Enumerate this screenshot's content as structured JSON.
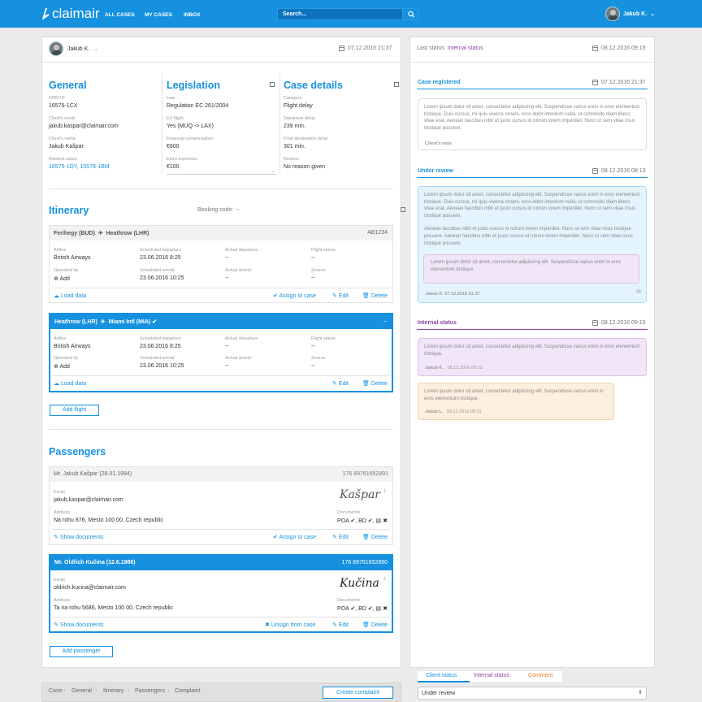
{
  "brand": {
    "name": "claimair"
  },
  "nav": {
    "all_cases": "ALL CASES",
    "my_cases": "MY CASES",
    "inbox": "INBOX"
  },
  "search": {
    "placeholder": "Search..."
  },
  "user": {
    "name": "Jakub K."
  },
  "left": {
    "assignee": "Jakub K.",
    "date": "07.12.2016 21:37",
    "general": {
      "title": "General",
      "crm_lbl": "CRM ID",
      "crm": "16576-1CX",
      "email_lbl": "Client's email",
      "email": "jakub.kaspar@claimair.com",
      "name_lbl": "Client's name",
      "name": "Jakub Kašpar",
      "rel_lbl": "Related cases",
      "rel": "16575-1DY, 15578-1BM"
    },
    "legislation": {
      "title": "Legislation",
      "law_lbl": "Law",
      "law": "Regulation EC 261/2004",
      "eu_lbl": "EU flight",
      "eu": "Yes (MUQ -> LAX)",
      "comp_lbl": "Financial compensation",
      "comp": "€600",
      "extra_lbl": "Extra expenses",
      "extra": "€100"
    },
    "details": {
      "title": "Case details",
      "cat_lbl": "Category",
      "cat": "Flight delay",
      "dep_lbl": "Departure delay",
      "dep": "239 min.",
      "fin_lbl": "Final destination delay",
      "fin": "301 min.",
      "reason_lbl": "Reason",
      "reason": "No reason given"
    },
    "itinerary": {
      "title": "Itinerary",
      "booking": "Booking code: --",
      "flights": [
        {
          "from": "Ferihegy (BUD)",
          "to": "Heathrow (LHR)",
          "code": "AB1234",
          "airline_lbl": "Airline",
          "airline": "British Airways",
          "sdep_lbl": "Scheduled departure",
          "sdep": "23.06.2016 8:25",
          "adep_lbl": "Actual departure",
          "adep": "--",
          "status_lbl": "Flight status",
          "status": "--",
          "op_lbl": "Operated by",
          "op": "Add",
          "sarr_lbl": "Scheduled arrival",
          "sarr": "23.06.2016 10:25",
          "aarr_lbl": "Actual arrival",
          "aarr": "--",
          "src_lbl": "Source",
          "src": "--",
          "load": "Load data",
          "assign": "Assign to case",
          "edit": "Edit",
          "del": "Delete"
        },
        {
          "from": "Heathrow (LHR)",
          "to": "Miami Intl (MIA)",
          "code": "–",
          "airline_lbl": "Airline",
          "airline": "British Airways",
          "sdep_lbl": "Scheduled departure",
          "sdep": "23.06.2016 8:25",
          "adep_lbl": "Actual departure",
          "adep": "--",
          "status_lbl": "Flight status",
          "status": "--",
          "op_lbl": "Operated by",
          "op": "Add",
          "sarr_lbl": "Scheduled arrival",
          "sarr": "23.06.2016 10:25",
          "aarr_lbl": "Actual arrival",
          "aarr": "--",
          "src_lbl": "Source",
          "src": "--",
          "load": "Load data",
          "edit": "Edit",
          "del": "Delete"
        }
      ],
      "add_flight": "Add flight"
    },
    "passengers": {
      "title": "Passengers",
      "list": [
        {
          "name": "Mr. Jakub Kašpar (28.01.1994)",
          "num": "176 89761652891",
          "email_lbl": "Email",
          "email": "jakub.kaspar@claimair.com",
          "addr_lbl": "Address",
          "addr": "Na rohu 876, Mesto 100 00, Czech republic",
          "docs_lbl": "Documents",
          "docs": "POA ✔, BD ✔, ▤ ✖",
          "sig": "Kašpar",
          "show": "Show documents",
          "assign": "Assign to case",
          "edit": "Edit",
          "del": "Delete"
        },
        {
          "name": "Mr. Oldřich Kučina (12.6.1986)",
          "num": "176 89761652890",
          "email_lbl": "Email",
          "email": "oldrich.kucina@claimair.com",
          "addr_lbl": "Address",
          "addr": "Ta na rohu 5686, Mesto 100 00, Czech republic",
          "docs_lbl": "Documents",
          "docs": "POA ✔, BD ✔, ▤ ✖",
          "sig": "Kučina",
          "show": "Show documents",
          "unsign": "Unsign from case",
          "edit": "Edit",
          "del": "Delete"
        }
      ],
      "add": "Add passenger"
    }
  },
  "right": {
    "last_status_lbl": "Last status:",
    "last_status": "Internal status",
    "date": "08.12.2016 09:15",
    "case_registered": {
      "title": "Case registered",
      "date": "07.12.2016 21:37",
      "text": "Lorem ipsum dolor sit amet, consectetur adipiscing elit. Suspendisse varius enim in eros elementum tristique. Duis cursus, mi quis viverra ornare, eros dolor interdum nulla, ut commodo diam libero vitae erat. Aenean faucibus nibh et justo cursus id rutrum lorem imperdiet. Nunc ut sem vitae risus tristique posuere.",
      "who": "Client's note"
    },
    "under_review": {
      "title": "Under review",
      "date": "08.12.2016 08:13",
      "text1": "Lorem ipsum dolor sit amet, consectetur adipiscing elit. Suspendisse varius enim in eros elementum tristique. Duis cursus, mi quis viverra ornare, eros dolor interdum nulla, ut commodo diam libero vitae erat. Aenean faucibus nibh et justo cursus id rutrum lorem imperdiet. Nunc ut sem vitae risus tristique posuere.",
      "text2": "Aenean faucibus nibh et justo cursus id rutrum lorem imperdiet. Nunc ut sem vitae risus tristique posuere. Aenean faucibus nibh et justo cursus id rutrum lorem imperdiet. Nunc ut sem vitae risus tristique posuere.",
      "inner": "Lorem ipsum dolor sit amet, consectetur adipiscing elit. Suspendisse varius enim in eros elementum tristique.",
      "who": "Jakub K. 07.12.2016 21:37"
    },
    "internal": {
      "title": "Internal status",
      "date": "08.12.2016 09:15",
      "note1": "Lorem ipsum dolor sit amet, consectetur adipiscing elit. Suspendisse varius enim in eros elementum tristique.",
      "who1": "Jakub K.",
      "date1": "08.12.2016 09:15",
      "note2": "Lorem ipsum dolor sit amet, consectetur adipiscing elit. Suspendisse varius enim in eros elementum tristique.",
      "who2": "Jakub L.",
      "date2": "08.12.2016 09:31"
    }
  },
  "bottom": {
    "crumbs": [
      "Case",
      "General",
      "Itinerary",
      "Passengers",
      "Complaint"
    ],
    "create": "Create complaint",
    "tabs": [
      "Client status",
      "Internal status",
      "Comment"
    ],
    "select": "Under review"
  },
  "colors": {
    "primary": "#1591df",
    "internal": "#8e44ad",
    "comment": "#e67e22"
  }
}
